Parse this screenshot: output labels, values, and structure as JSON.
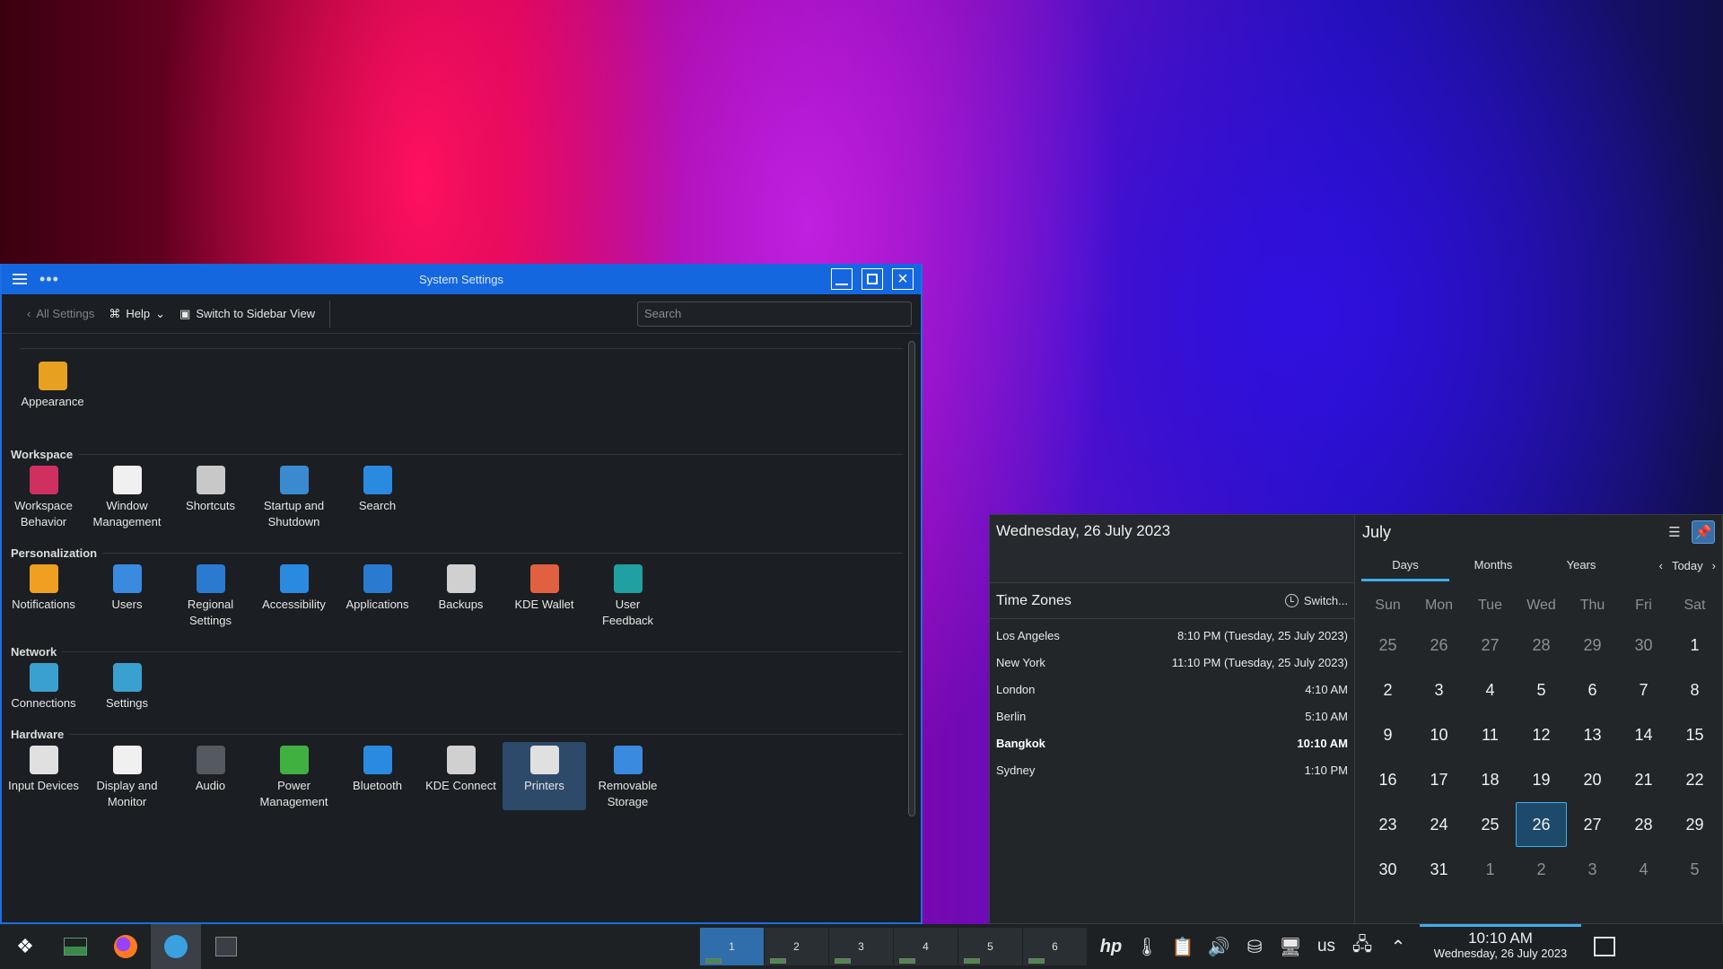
{
  "window": {
    "title": "System Settings",
    "toolbar": {
      "back_label": "All Settings",
      "help_label": "Help",
      "switch_label": "Switch to Sidebar View",
      "search_placeholder": "Search"
    },
    "top_items": [
      {
        "label": "Appearance",
        "icon": "appearance-icon",
        "color": "#e8a020"
      }
    ],
    "sections": [
      {
        "title": "Workspace",
        "items": [
          {
            "label": "Workspace\nBehavior",
            "icon": "workspace-behavior-icon",
            "color": "#d03060"
          },
          {
            "label": "Window\nManagement",
            "icon": "window-management-icon",
            "color": "#f0f0f0"
          },
          {
            "label": "Shortcuts",
            "icon": "keyboard-icon",
            "color": "#c8c8c8"
          },
          {
            "label": "Startup and\nShutdown",
            "icon": "startup-icon",
            "color": "#3a8ad0"
          },
          {
            "label": "Search",
            "icon": "search-icon",
            "color": "#2a8ae0"
          }
        ]
      },
      {
        "title": "Personalization",
        "items": [
          {
            "label": "Notifications",
            "icon": "bell-icon",
            "color": "#f0a020"
          },
          {
            "label": "Users",
            "icon": "users-icon",
            "color": "#3a8ae0"
          },
          {
            "label": "Regional\nSettings",
            "icon": "regional-icon",
            "color": "#2a7ad0"
          },
          {
            "label": "Accessibility",
            "icon": "accessibility-icon",
            "color": "#2a8ae0"
          },
          {
            "label": "Applications",
            "icon": "applications-icon",
            "color": "#2a7ad0"
          },
          {
            "label": "Backups",
            "icon": "backups-icon",
            "color": "#d0d0d0"
          },
          {
            "label": "KDE Wallet",
            "icon": "wallet-icon",
            "color": "#e06040"
          },
          {
            "label": "User\nFeedback",
            "icon": "feedback-icon",
            "color": "#20a0a0"
          }
        ]
      },
      {
        "title": "Network",
        "items": [
          {
            "label": "Connections",
            "icon": "globe-icon",
            "color": "#3aa0d0"
          },
          {
            "label": "Settings",
            "icon": "globe-settings-icon",
            "color": "#3aa0d0"
          }
        ]
      },
      {
        "title": "Hardware",
        "items": [
          {
            "label": "Input Devices",
            "icon": "mouse-icon",
            "color": "#e0e0e0"
          },
          {
            "label": "Display and\nMonitor",
            "icon": "monitor-icon",
            "color": "#f0f0f0"
          },
          {
            "label": "Audio",
            "icon": "speaker-icon",
            "color": "#555a60"
          },
          {
            "label": "Power\nManagement",
            "icon": "power-icon",
            "color": "#40b040"
          },
          {
            "label": "Bluetooth",
            "icon": "bluetooth-icon",
            "color": "#2a8ae0"
          },
          {
            "label": "KDE Connect",
            "icon": "phone-icon",
            "color": "#d0d0d0"
          },
          {
            "label": "Printers",
            "icon": "printer-icon",
            "color": "#e0e0e0",
            "selected": true
          },
          {
            "label": "Removable\nStorage",
            "icon": "usb-icon",
            "color": "#3a8ae0"
          }
        ]
      }
    ]
  },
  "popup": {
    "full_date": "Wednesday, 26 July 2023",
    "tz_title": "Time Zones",
    "tz_switch": "Switch...",
    "zones": [
      {
        "city": "Los Angeles",
        "time": "8:10 PM (Tuesday, 25 July 2023)"
      },
      {
        "city": "New York",
        "time": "11:10 PM (Tuesday, 25 July 2023)"
      },
      {
        "city": "London",
        "time": "4:10 AM"
      },
      {
        "city": "Berlin",
        "time": "5:10 AM"
      },
      {
        "city": "Bangkok",
        "time": "10:10 AM",
        "bold": true
      },
      {
        "city": "Sydney",
        "time": "1:10 PM"
      }
    ],
    "calendar": {
      "month": "July",
      "tabs": [
        "Days",
        "Months",
        "Years"
      ],
      "today_label": "Today",
      "weekdays": [
        "Sun",
        "Mon",
        "Tue",
        "Wed",
        "Thu",
        "Fri",
        "Sat"
      ],
      "days": [
        [
          25,
          "o"
        ],
        [
          26,
          "o"
        ],
        [
          27,
          "o"
        ],
        [
          28,
          "o"
        ],
        [
          29,
          "o"
        ],
        [
          30,
          "o"
        ],
        [
          1,
          ""
        ],
        [
          2,
          ""
        ],
        [
          3,
          ""
        ],
        [
          4,
          ""
        ],
        [
          5,
          ""
        ],
        [
          6,
          ""
        ],
        [
          7,
          ""
        ],
        [
          8,
          ""
        ],
        [
          9,
          ""
        ],
        [
          10,
          ""
        ],
        [
          11,
          ""
        ],
        [
          12,
          ""
        ],
        [
          13,
          ""
        ],
        [
          14,
          ""
        ],
        [
          15,
          ""
        ],
        [
          16,
          ""
        ],
        [
          17,
          ""
        ],
        [
          18,
          ""
        ],
        [
          19,
          ""
        ],
        [
          20,
          ""
        ],
        [
          21,
          ""
        ],
        [
          22,
          ""
        ],
        [
          23,
          ""
        ],
        [
          24,
          ""
        ],
        [
          25,
          ""
        ],
        [
          26,
          "t"
        ],
        [
          27,
          ""
        ],
        [
          28,
          ""
        ],
        [
          29,
          ""
        ],
        [
          30,
          ""
        ],
        [
          31,
          ""
        ],
        [
          1,
          "o"
        ],
        [
          2,
          "o"
        ],
        [
          3,
          "o"
        ],
        [
          4,
          "o"
        ],
        [
          5,
          "o"
        ]
      ]
    }
  },
  "taskbar": {
    "pager": [
      "1",
      "2",
      "3",
      "4",
      "5",
      "6"
    ],
    "keyboard_layout": "us",
    "clock_time": "10:10 AM",
    "clock_date": "Wednesday, 26 July 2023"
  }
}
